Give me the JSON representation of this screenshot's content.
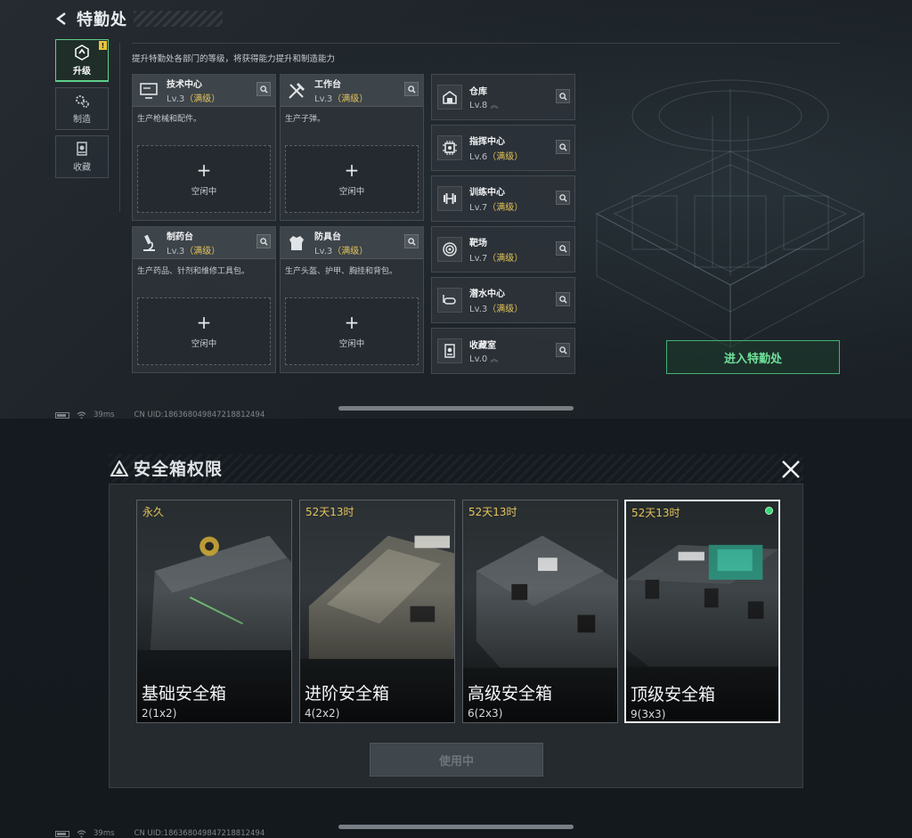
{
  "top": {
    "title": "特勤处",
    "sidenav": [
      {
        "label": "升级",
        "icon": "upgrade-icon",
        "active": true,
        "alert": "!"
      },
      {
        "label": "制造",
        "icon": "gears-icon",
        "active": false
      },
      {
        "label": "收藏",
        "icon": "collection-icon",
        "active": false
      }
    ],
    "intro": "提升特勤处各部门的等级，将获得能力提升和制造能力",
    "facilities": [
      {
        "name": "技术中心",
        "lv": "Lv.3",
        "max": "（满级）",
        "desc": "生产枪械和配件。",
        "slot": "空闲中",
        "plus": "+",
        "icon": "monitor-icon"
      },
      {
        "name": "工作台",
        "lv": "Lv.3",
        "max": "（满级）",
        "desc": "生产子弹。",
        "slot": "空闲中",
        "plus": "+",
        "icon": "tools-icon"
      },
      {
        "name": "制药台",
        "lv": "Lv.3",
        "max": "（满级）",
        "desc": "生产药品、针剂和维修工具包。",
        "slot": "空闲中",
        "plus": "+",
        "icon": "microscope-icon"
      },
      {
        "name": "防具台",
        "lv": "Lv.3",
        "max": "（满级）",
        "desc": "生产头盔、护甲、胸挂和背包。",
        "slot": "空闲中",
        "plus": "+",
        "icon": "armor-icon"
      }
    ],
    "rooms": [
      {
        "name": "仓库",
        "lv": "Lv.8",
        "max": "",
        "up": "︽",
        "icon": "warehouse-icon"
      },
      {
        "name": "指挥中心",
        "lv": "Lv.6",
        "max": "（满级）",
        "up": "",
        "icon": "chip-icon"
      },
      {
        "name": "训练中心",
        "lv": "Lv.7",
        "max": "（满级）",
        "up": "",
        "icon": "dumbbell-icon"
      },
      {
        "name": "靶场",
        "lv": "Lv.7",
        "max": "（满级）",
        "up": "",
        "icon": "target-icon"
      },
      {
        "name": "潜水中心",
        "lv": "Lv.3",
        "max": "（满级）",
        "up": "",
        "icon": "diving-mask-icon"
      },
      {
        "name": "收藏室",
        "lv": "Lv.0",
        "max": "",
        "up": "︽",
        "icon": "display-case-icon"
      }
    ],
    "enter_button": "进入特勤处",
    "status": {
      "ping": "39ms",
      "uid": "CN UID:18636804984721881249​4"
    }
  },
  "bottom": {
    "title": "安全箱权限",
    "boxes": [
      {
        "duration": "永久",
        "name": "基础安全箱",
        "capacity": "2(1x2)",
        "selected": false
      },
      {
        "duration": "52天13时",
        "name": "进阶安全箱",
        "capacity": "4(2x2)",
        "selected": false
      },
      {
        "duration": "52天13时",
        "name": "高级安全箱",
        "capacity": "6(2x3)",
        "selected": false
      },
      {
        "duration": "52天13时",
        "name": "顶级安全箱",
        "capacity": "9(3x3)",
        "selected": true
      }
    ],
    "use_button": "使用中",
    "status": {
      "ping": "39ms",
      "uid": "CN UID:18636804984721881249​4"
    }
  },
  "colors": {
    "accent_green": "#5fd08a",
    "max_level": "#e3c35a",
    "duration": "#e3c35a"
  }
}
